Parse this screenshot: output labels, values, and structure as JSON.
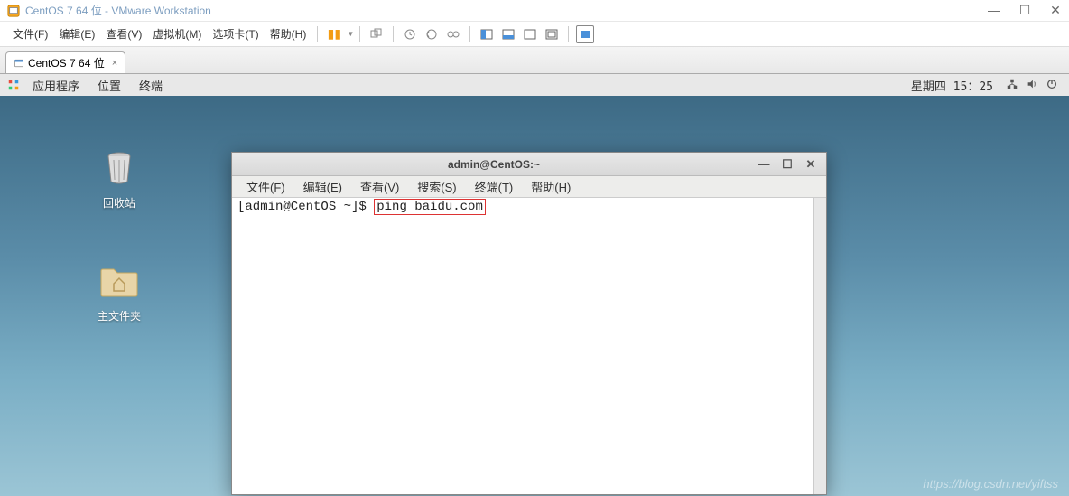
{
  "vmware": {
    "title": "CentOS 7 64 位 - VMware Workstation",
    "menu": {
      "file": "文件(F)",
      "edit": "编辑(E)",
      "view": "查看(V)",
      "vm": "虚拟机(M)",
      "tabs": "选项卡(T)",
      "help": "帮助(H)"
    },
    "tab_label": "CentOS 7 64 位",
    "tab_close": "×",
    "win_min": "—",
    "win_max": "☐",
    "win_close": "✕"
  },
  "gnome": {
    "apps": "应用程序",
    "places": "位置",
    "terminal": "终端",
    "clock": "星期四 15：25"
  },
  "desktop": {
    "trash": "回收站",
    "home": "主文件夹"
  },
  "terminal": {
    "title": "admin@CentOS:~",
    "menu": {
      "file": "文件(F)",
      "edit": "编辑(E)",
      "view": "查看(V)",
      "search": "搜索(S)",
      "terminal": "终端(T)",
      "help": "帮助(H)"
    },
    "prompt": "[admin@CentOS ~]$ ",
    "command": "ping baidu.com",
    "win_min": "—",
    "win_max": "☐",
    "win_close": "✕"
  },
  "watermark": "https://blog.csdn.net/yiftss"
}
